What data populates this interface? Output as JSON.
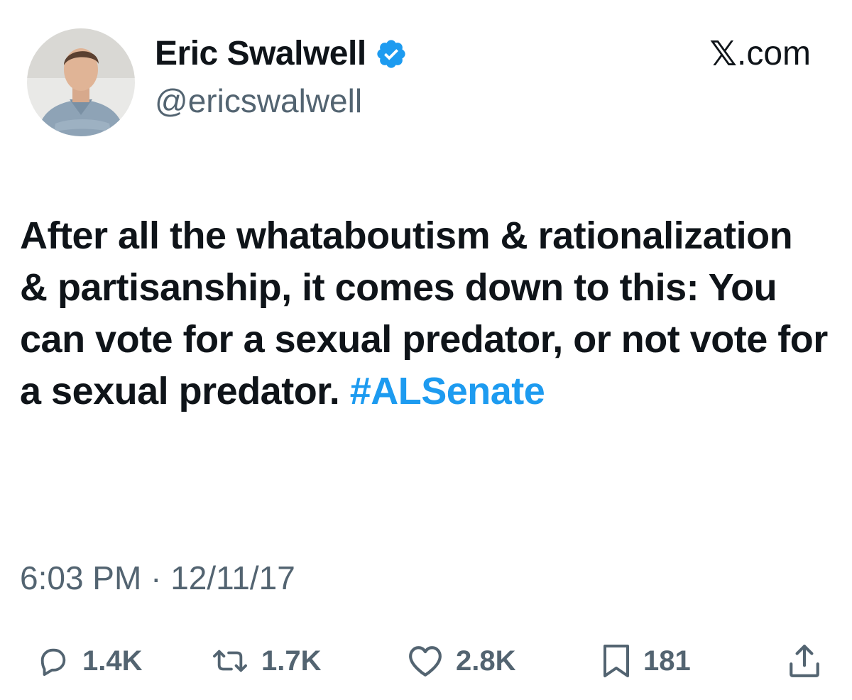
{
  "author": {
    "display_name": "Eric Swalwell",
    "handle": "@ericswalwell",
    "verified_icon": "verified-badge-icon",
    "verified_color": "#1d9bf0"
  },
  "source": {
    "logo_glyph": "𝕏",
    "suffix": ".com"
  },
  "tweet": {
    "text": "After all the whataboutism & rationalization & partisanship, it comes down to this: You can vote for a sexual predator, or not vote for a sexual predator. ",
    "hashtag": "#ALSenate",
    "hashtag_color": "#1d9bf0"
  },
  "timestamp": "6:03 PM · 12/11/17",
  "actions": {
    "reply": {
      "icon": "reply-icon",
      "count": "1.4K"
    },
    "retweet": {
      "icon": "retweet-icon",
      "count": "1.7K"
    },
    "like": {
      "icon": "heart-icon",
      "count": "2.8K"
    },
    "bookmark": {
      "icon": "bookmark-icon",
      "count": "181"
    },
    "share": {
      "icon": "share-icon"
    }
  },
  "colors": {
    "text": "#0f1419",
    "secondary": "#536471",
    "accent": "#1d9bf0"
  }
}
